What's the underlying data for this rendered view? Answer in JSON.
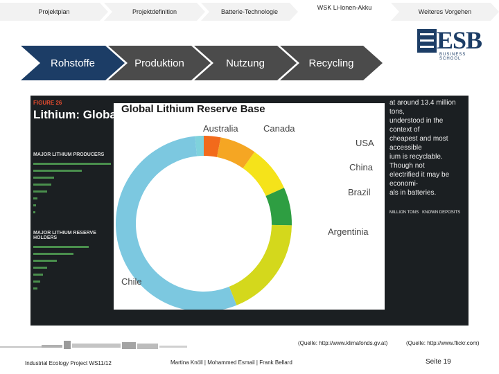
{
  "top_nav": [
    "Projektplan",
    "Projektdefinition",
    "Batterie-Technologie",
    "WSK Li-Ionen-Akku",
    "Weiteres Vorgehen"
  ],
  "sub_nav": [
    "Rohstoffe",
    "Produktion",
    "Nutzung",
    "Recycling"
  ],
  "logo": {
    "word": "ESB",
    "sub": "BUSINESS SCHOOL"
  },
  "infographic": {
    "figure_label": "FIGURE 26",
    "title": "Lithium: Global Stat",
    "left_sections": [
      "MAJOR LITHIUM PRODUCERS",
      "MAJOR LITHIUM RESERVE HOLDERS"
    ],
    "right_text": [
      "at around 13.4 million tons,",
      "understood in the context of",
      "cheapest and most accessible",
      "ium is recyclable. Though not",
      "electrified it may be economi-",
      "als in batteries."
    ],
    "legend": [
      "MILLION TONS",
      "KNOWN DEPOSITS"
    ]
  },
  "chart_data": {
    "type": "pie",
    "title": "Global Lithium Reserve Base",
    "categories": [
      "Australia",
      "Canada",
      "USA",
      "China",
      "Brazil",
      "Argentinia",
      "Chile"
    ],
    "values": [
      1.6,
      3.1,
      6.7,
      8.5,
      7.0,
      18.6,
      54.5
    ],
    "colors": [
      "#7fd2dc",
      "#f26a1b",
      "#f5a623",
      "#f5e31a",
      "#2e9e42",
      "#d4d81c",
      "#7cc8e0"
    ],
    "extra_segment_color": "#1da6be"
  },
  "sources": [
    "(Quelle: http://www.klimafonds.gv.at)",
    "(Quelle: http://www.flickr.com)"
  ],
  "footer": {
    "course": "Industrial Ecology Project WS11/12",
    "authors": "Martina Knöll   |   Mohammed Esmail   |   Frank Bellard",
    "page": "Seite  19"
  }
}
